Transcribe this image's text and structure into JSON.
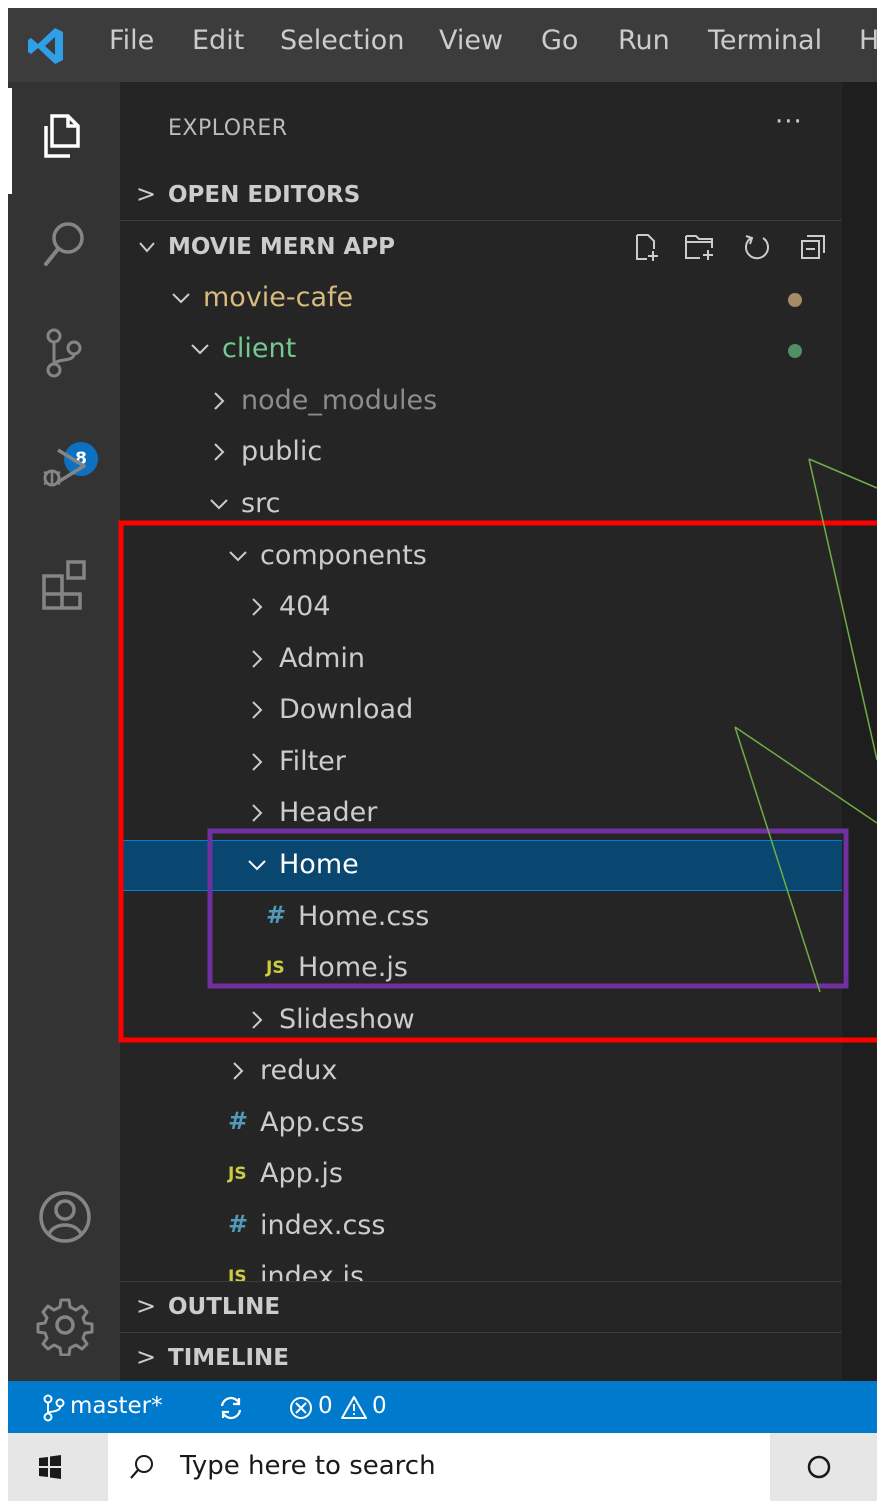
{
  "menubar": {
    "items": [
      "File",
      "Edit",
      "Selection",
      "View",
      "Go",
      "Run",
      "Terminal",
      "H"
    ]
  },
  "activity_bar": {
    "icons": [
      "explorer-icon",
      "search-icon",
      "source-control-icon",
      "run-debug-icon",
      "extensions-icon",
      "accounts-icon",
      "manage-gear-icon"
    ],
    "scm_badge": "8"
  },
  "explorer": {
    "title": "EXPLORER",
    "more": "···",
    "open_editors": "OPEN EDITORS",
    "workspace": "MOVIE MERN APP",
    "outline": "OUTLINE",
    "timeline": "TIMELINE",
    "header_actions": [
      "new-file-icon",
      "new-folder-icon",
      "refresh-icon",
      "collapse-all-icon"
    ],
    "tree": [
      {
        "label": "movie-cafe",
        "type": "folder",
        "open": true,
        "color": "#d7ba7d",
        "dot": "#a58b67"
      },
      {
        "label": "client",
        "type": "folder",
        "open": true,
        "color": "#73c991",
        "dot": "#4f8f63"
      },
      {
        "label": "node_modules",
        "type": "folder",
        "open": false,
        "color": "#8c8c8c"
      },
      {
        "label": "public",
        "type": "folder",
        "open": false,
        "color": "#cccccc"
      },
      {
        "label": "src",
        "type": "folder",
        "open": true,
        "color": "#cccccc"
      },
      {
        "label": "components",
        "type": "folder",
        "open": true,
        "color": "#cccccc"
      },
      {
        "label": "404",
        "type": "folder",
        "open": false,
        "color": "#cccccc"
      },
      {
        "label": "Admin",
        "type": "folder",
        "open": false,
        "color": "#cccccc"
      },
      {
        "label": "Download",
        "type": "folder",
        "open": false,
        "color": "#cccccc"
      },
      {
        "label": "Filter",
        "type": "folder",
        "open": false,
        "color": "#cccccc"
      },
      {
        "label": "Header",
        "type": "folder",
        "open": false,
        "color": "#cccccc"
      },
      {
        "label": "Home",
        "type": "folder",
        "open": true,
        "color": "#ffffff",
        "selected": true
      },
      {
        "label": "Home.css",
        "type": "css",
        "color": "#cccccc"
      },
      {
        "label": "Home.js",
        "type": "js",
        "color": "#cccccc"
      },
      {
        "label": "Slideshow",
        "type": "folder",
        "open": false,
        "color": "#cccccc"
      },
      {
        "label": "redux",
        "type": "folder",
        "open": false,
        "color": "#cccccc"
      },
      {
        "label": "App.css",
        "type": "css",
        "color": "#cccccc"
      },
      {
        "label": "App.js",
        "type": "js",
        "color": "#cccccc"
      },
      {
        "label": "index.css",
        "type": "css",
        "color": "#cccccc"
      },
      {
        "label": "index.js",
        "type": "js",
        "color": "#cccccc"
      }
    ],
    "file_icons": {
      "css": "#",
      "js": "JS"
    }
  },
  "statusbar": {
    "branch": "master*",
    "errors": "0",
    "warnings": "0"
  },
  "taskbar": {
    "search_placeholder": "Type here to search"
  },
  "colors": {
    "accent": "#007acc",
    "highlight_red": "#ff0000",
    "highlight_purple": "#7030a0",
    "annotation_green": "#70ad47"
  }
}
